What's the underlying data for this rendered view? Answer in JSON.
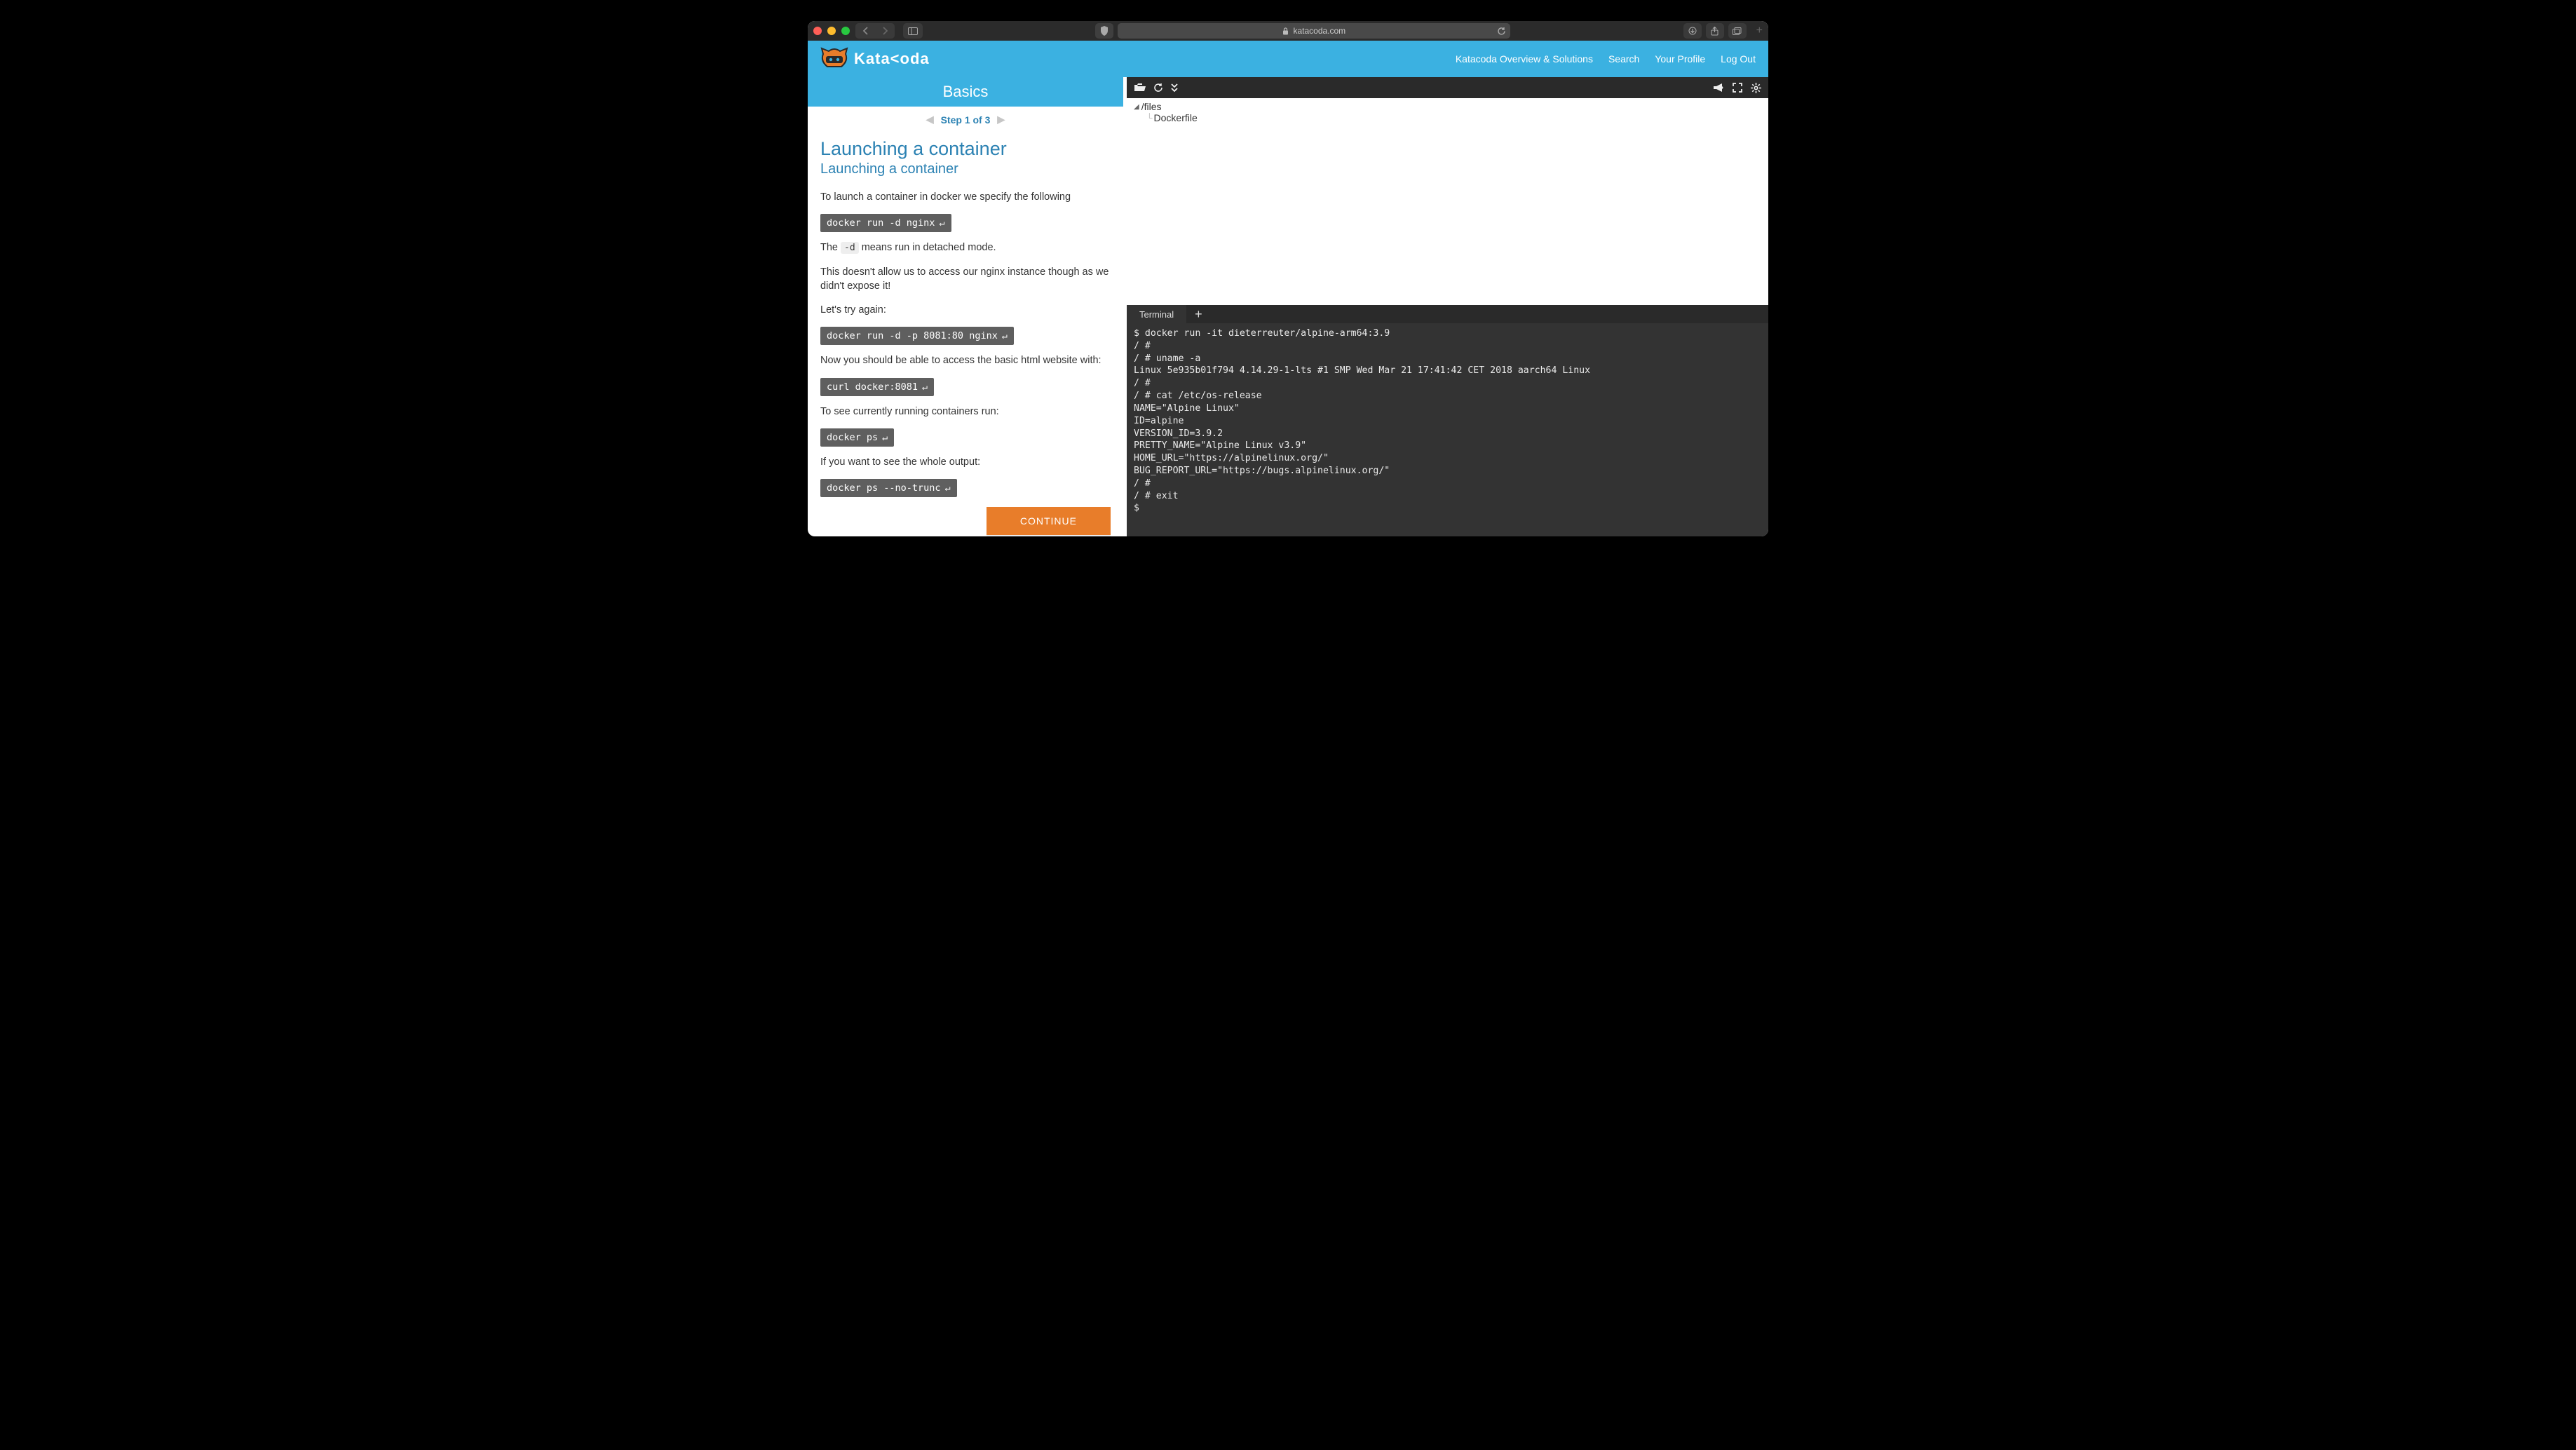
{
  "browser": {
    "url": "katacoda.com"
  },
  "header": {
    "brand": "Kata<oda",
    "nav": {
      "overview": "Katacoda Overview & Solutions",
      "search": "Search",
      "profile": "Your Profile",
      "logout": "Log Out"
    }
  },
  "lesson": {
    "title": "Basics",
    "step": "Step 1 of 3",
    "h1": "Launching a container",
    "h2": "Launching a container",
    "p_intro": "To launch a container in docker we specify the following",
    "code1": "docker run -d nginx",
    "p_d_pre": "The ",
    "code_flag_d": "-d",
    "p_d_post": " means run in detached mode.",
    "p_no_expose": "This doesn't allow us to access our nginx instance though as we didn't expose it!",
    "p_try": "Let's try again:",
    "code2": "docker run -d -p 8081:80 nginx",
    "p_access": "Now you should be able to access the basic html website with:",
    "code3": "curl docker:8081",
    "p_ps": "To see currently running containers run:",
    "code4": "docker ps",
    "p_trunc": "If you want to see the whole output:",
    "code5": "docker ps --no-trunc",
    "continue": "CONTINUE"
  },
  "filetree": {
    "root": "/files",
    "child": "Dockerfile"
  },
  "terminal": {
    "tab": "Terminal",
    "content": "$ docker run -it dieterreuter/alpine-arm64:3.9\n/ #\n/ # uname -a\nLinux 5e935b01f794 4.14.29-1-lts #1 SMP Wed Mar 21 17:41:42 CET 2018 aarch64 Linux\n/ #\n/ # cat /etc/os-release\nNAME=\"Alpine Linux\"\nID=alpine\nVERSION_ID=3.9.2\nPRETTY_NAME=\"Alpine Linux v3.9\"\nHOME_URL=\"https://alpinelinux.org/\"\nBUG_REPORT_URL=\"https://bugs.alpinelinux.org/\"\n/ #\n/ # exit\n$"
  }
}
